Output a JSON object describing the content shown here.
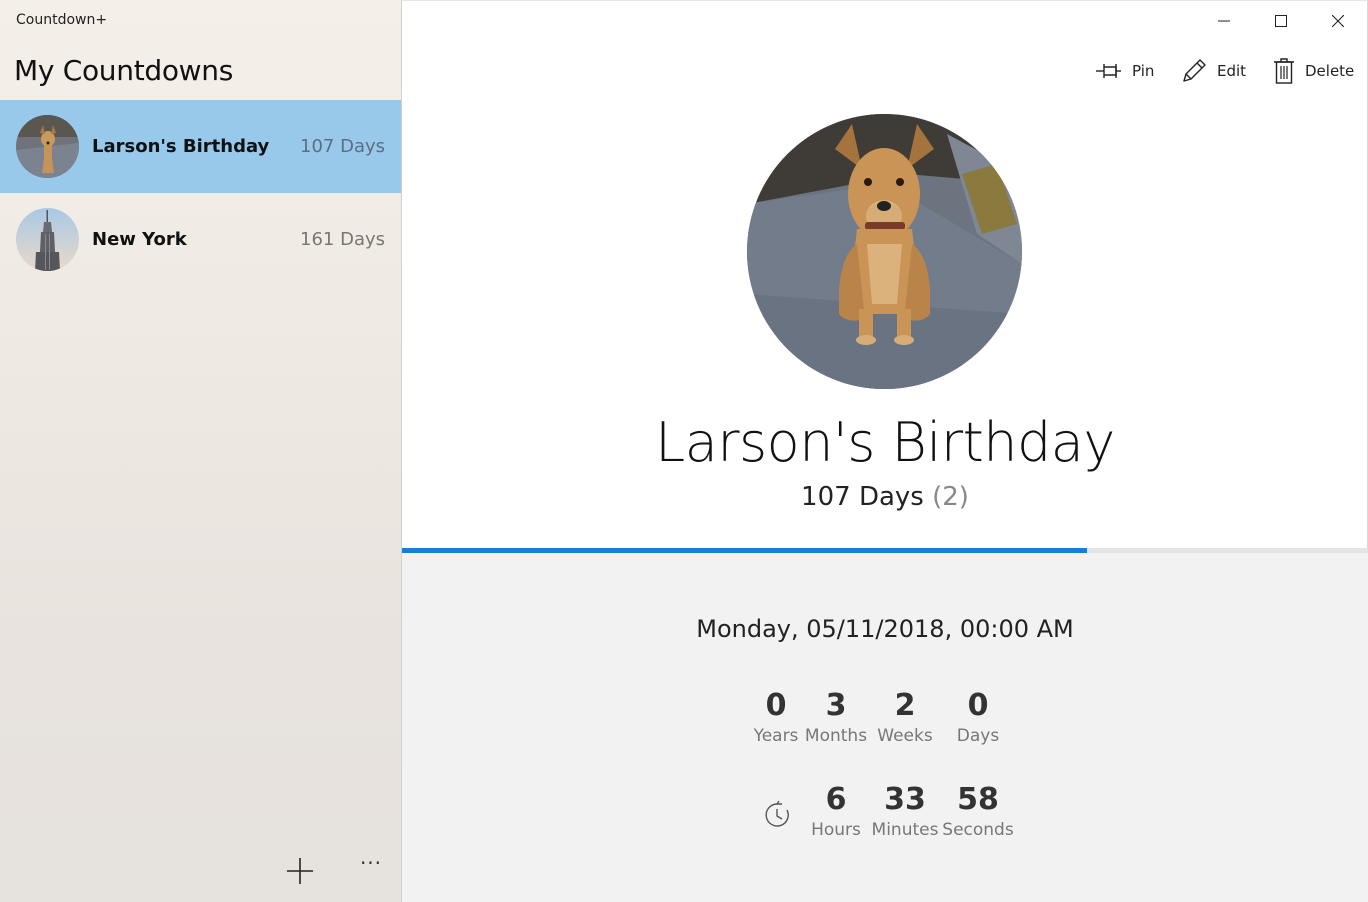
{
  "app": {
    "title": "Countdown+"
  },
  "sidebar": {
    "title": "My Countdowns",
    "items": [
      {
        "name": "Larson's Birthday",
        "days": "107 Days",
        "selected": true,
        "avatar": "dog-photo"
      },
      {
        "name": "New York",
        "days": "161 Days",
        "selected": false,
        "avatar": "empire-state-building-photo"
      }
    ],
    "add_icon": "plus-icon",
    "more_label": "···"
  },
  "window": {
    "minimize_icon": "minimize-icon",
    "maximize_icon": "maximize-icon",
    "close_icon": "close-icon"
  },
  "toolbar": {
    "pin_label": "Pin",
    "edit_label": "Edit",
    "delete_label": "Delete"
  },
  "detail": {
    "title": "Larson's Birthday",
    "days": "107 Days",
    "count": "(2)",
    "progress": 0.709,
    "date": "Monday, 05/11/2018, 00:00 AM",
    "date_units": [
      {
        "value": "0",
        "label": "Years"
      },
      {
        "value": "3",
        "label": "Months"
      },
      {
        "value": "2",
        "label": "Weeks"
      },
      {
        "value": "0",
        "label": "Days"
      }
    ],
    "time_units": [
      {
        "value": "6",
        "label": "Hours"
      },
      {
        "value": "33",
        "label": "Minutes"
      },
      {
        "value": "58",
        "label": "Seconds"
      }
    ]
  },
  "colors": {
    "accent": "#1a7fd4",
    "selected_bg": "#99c9ea",
    "details_bg": "#f2f2f2"
  }
}
